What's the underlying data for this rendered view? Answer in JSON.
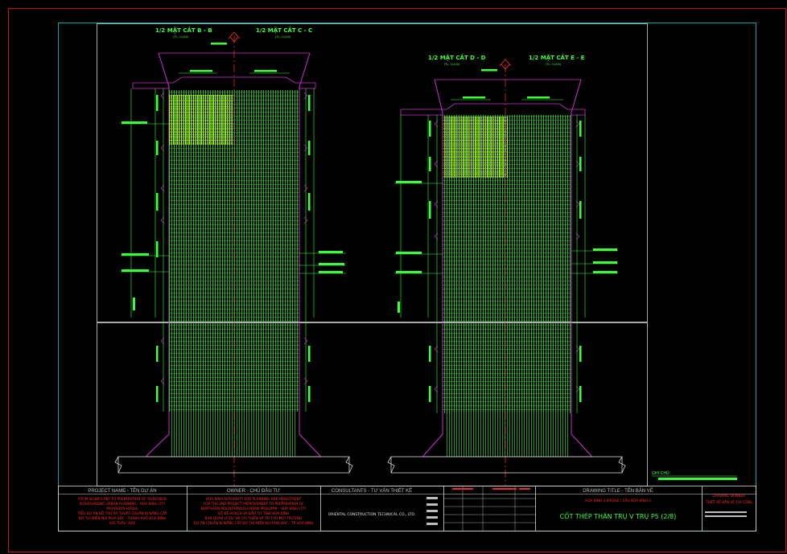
{
  "colors": {
    "background": "#000000",
    "outer_frame": "#c0142b",
    "inner_frame": "#14a3a3",
    "rebar": "#33ff33",
    "rebar_dense": "#d4ff2a",
    "outline": "#cc33cc",
    "axis": "#ff3030",
    "text_green": "#3cff3c",
    "text_red": "#ff2a2a",
    "text_white": "#e8e8e8"
  },
  "left_pier": {
    "title_left": "1/2 MẶT CẮT B - B",
    "title_right": "1/2 MẶT CẮT C - C",
    "scale_left": "(TL: 1/100)",
    "scale_right": "(TL: 1/100)"
  },
  "right_pier": {
    "title_left": "1/2 MẶT CẮT D - D",
    "title_right": "1/2 MẶT CẮT E - E",
    "scale_left": "(TL: 1/100)",
    "scale_right": "(TL: 1/100)"
  },
  "note_label": "GHI CHÚ:",
  "title_block": {
    "project_header": "PROJECT NAME - TÊN DỰ ÁN",
    "project_lines": [
      "FROM SIGNIFICANT TO PREPARATION OF THIRD NEW",
      "SURROUNDING URBAN PLANNING - HOA BINH CITY",
      "PROVISION HOUSE",
      "TIỂU DỰ ÁN HỖ TRỢ KỸ THUẬT CHUẨN BỊ NÂNG CẤP",
      "ĐÔ THỊ MIỀN NÚI PHÍA BẮC - THÀNH PHỐ HÒA BÌNH",
      "GÓI THẦU: HH5"
    ],
    "owner_header": "OWNER - CHỦ ĐẦU TƯ",
    "owner_lines": [
      "HOA BINH AUTHORITY FOR PLANNING AND INVESTMENT",
      "FOR THE 2ND PROJECT IMPROVEMENT TO PREPARATION OF",
      "NORTHERN MOUNTAINOUS URBAN PROGRAM - HOA BINH CITY",
      "SỞ KẾ HOẠCH VÀ ĐẦU TƯ TỈNH HÒA BÌNH",
      "BAN QUẢN LÝ DỰ ÁN CẢI THIỆN VÀ TÁI TẠO MÔI TRƯỜNG",
      "DỰ ÁN CHUẨN BỊ NÂNG CẤP ĐÔ THỊ MIỀN NÚI PHÍA BẮC - TP HÒA BÌNH"
    ],
    "consultant_header": "CONSULTANTS - TƯ VẤN THIẾT KẾ",
    "consultant_name": "ORIENTAL CONSTRUCTION TECHNICAL CO., LTD.",
    "drawing_header": "DRAWING TITLE - TÊN BẢN VẼ",
    "drawing_subtitle": "HOA BINH 3 BRIDGE / CẦU HÒA BÌNH 3",
    "drawing_title": "CỐT THÉP THÂN TRỤ V TRỤ P5 (2/8)",
    "drawing_no_header": "DRAWING NUMBER",
    "drawing_no": "THIẾT KẾ BẢN VẼ THI CÔNG"
  }
}
